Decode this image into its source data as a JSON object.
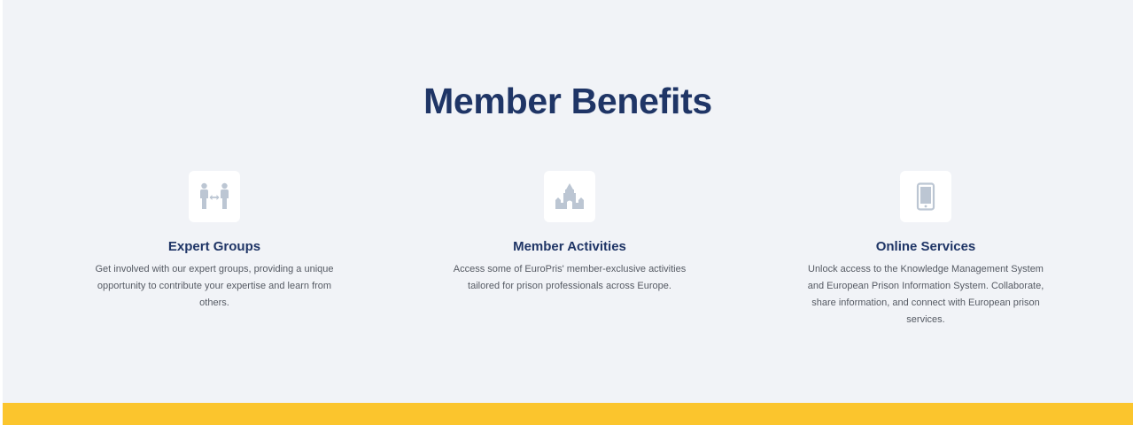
{
  "section": {
    "title": "Member Benefits"
  },
  "benefits": [
    {
      "icon": "people-exchange-icon",
      "title": "Expert Groups",
      "text": "Get involved with our expert groups, providing a unique opportunity to contribute your expertise and learn from others."
    },
    {
      "icon": "building-icon",
      "title": "Member Activities",
      "text": "Access some of EuroPris' member-exclusive activities tailored for prison professionals across Europe."
    },
    {
      "icon": "mobile-phone-icon",
      "title": "Online Services",
      "text": "Unlock access to the Knowledge Management System and European Prison Information System. Collaborate, share information, and connect with European prison services."
    }
  ],
  "colors": {
    "section_bg": "#f1f3f7",
    "title": "#1f3566",
    "icon": "#bcc6d3",
    "accent_bar": "#fbc52d"
  }
}
